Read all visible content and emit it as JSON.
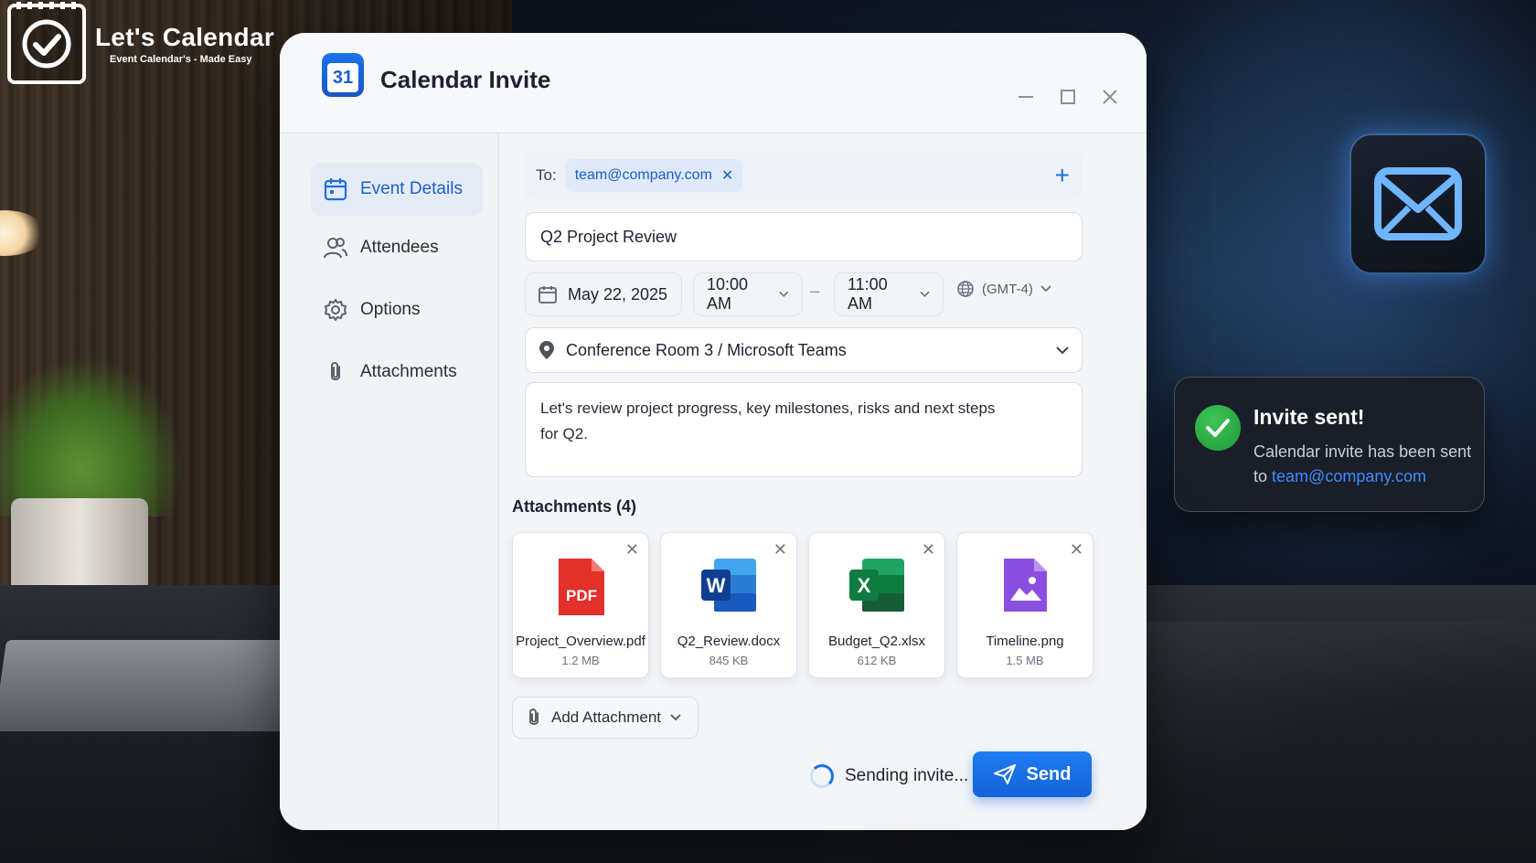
{
  "brand": {
    "title": "Let's Calendar",
    "subtitle": "Event Calendar's - Made Easy"
  },
  "window": {
    "icon_day": "31",
    "title": "Calendar Invite",
    "controls": [
      "minimize-icon",
      "maximize-icon",
      "close-icon"
    ]
  },
  "sidebar": {
    "items": [
      {
        "label": "Event Details",
        "icon": "calendar-icon",
        "active": true
      },
      {
        "label": "Attendees",
        "icon": "users-icon",
        "active": false
      },
      {
        "label": "Options",
        "icon": "gear-icon",
        "active": false
      },
      {
        "label": "Attachments",
        "icon": "paperclip-icon",
        "active": false
      }
    ]
  },
  "form": {
    "to_label": "To:",
    "recipients": [
      "team@company.com"
    ],
    "subject": "Q2 Project Review",
    "date": "May 22, 2025",
    "start_time": "10:00 AM",
    "end_time": "11:00 AM",
    "separator": "–",
    "timezone": "(GMT-4)",
    "location": "Conference Room 3 / Microsoft Teams",
    "description": "Let's review project progress, key milestones, risks and next steps for Q2."
  },
  "attachments": {
    "title": "Attachments",
    "count": "(4)",
    "items": [
      {
        "name": "Project_Overview.pdf",
        "size": "1.2 MB",
        "type": "pdf",
        "color": "#e2312b"
      },
      {
        "name": "Q2_Review.docx",
        "size": "845 KB",
        "type": "docx",
        "color": "#1e5bc6"
      },
      {
        "name": "Budget_Q2.xlsx",
        "size": "612 KB",
        "type": "xlsx",
        "color": "#1b7a3e"
      },
      {
        "name": "Timeline.png",
        "size": "1.5 MB",
        "type": "png",
        "color": "#8a4fe0"
      }
    ],
    "add_label": "Add Attachment"
  },
  "footer": {
    "status": "Sending invite...",
    "send_label": "Send"
  },
  "toast": {
    "title": "Invite sent!",
    "body": "Calendar invite has been sent to",
    "email": "team@company.com"
  },
  "colors": {
    "accent": "#1b6ee8",
    "success": "#2fb14a",
    "window_bg": "#f3f5f9"
  }
}
